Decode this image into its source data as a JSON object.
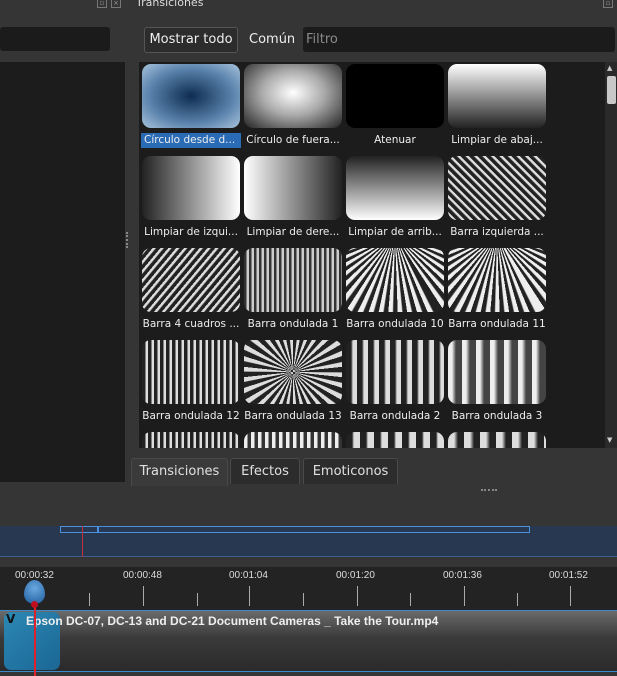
{
  "dock": {
    "title": "Transiciones"
  },
  "toolbar": {
    "show_all": "Mostrar todo",
    "common": "Común",
    "filter_placeholder": "Filtro"
  },
  "transitions": [
    {
      "label": "Círculo desde d...",
      "selected": true
    },
    {
      "label": "Círculo de fuera..."
    },
    {
      "label": "Atenuar"
    },
    {
      "label": "Limpiar de abaj..."
    },
    {
      "label": "Limpiar de izqui..."
    },
    {
      "label": "Limpiar de dere..."
    },
    {
      "label": "Limpiar de arrib..."
    },
    {
      "label": "Barra izquierda ..."
    },
    {
      "label": "Barra 4 cuadros ..."
    },
    {
      "label": "Barra ondulada 1"
    },
    {
      "label": "Barra ondulada 10"
    },
    {
      "label": "Barra ondulada 11"
    },
    {
      "label": "Barra ondulada 12"
    },
    {
      "label": "Barra ondulada 13"
    },
    {
      "label": "Barra ondulada 2"
    },
    {
      "label": "Barra ondulada 3"
    },
    {
      "label": ""
    },
    {
      "label": ""
    },
    {
      "label": ""
    },
    {
      "label": ""
    }
  ],
  "tabs": [
    {
      "label": "Transiciones",
      "active": true
    },
    {
      "label": "Efectos"
    },
    {
      "label": "Emoticonos"
    }
  ],
  "timeline": {
    "ticks": [
      "00:00:32",
      "00:00:48",
      "00:01:04",
      "00:01:20",
      "00:01:36",
      "00:01:52"
    ],
    "clip_title": "Epson DC-07, DC-13 and DC-21 Document Cameras _ Take the Tour.mp4"
  },
  "colors": {
    "selection": "#2a6bb5",
    "playhead": "#e0202a",
    "accent": "#3a8acc"
  }
}
